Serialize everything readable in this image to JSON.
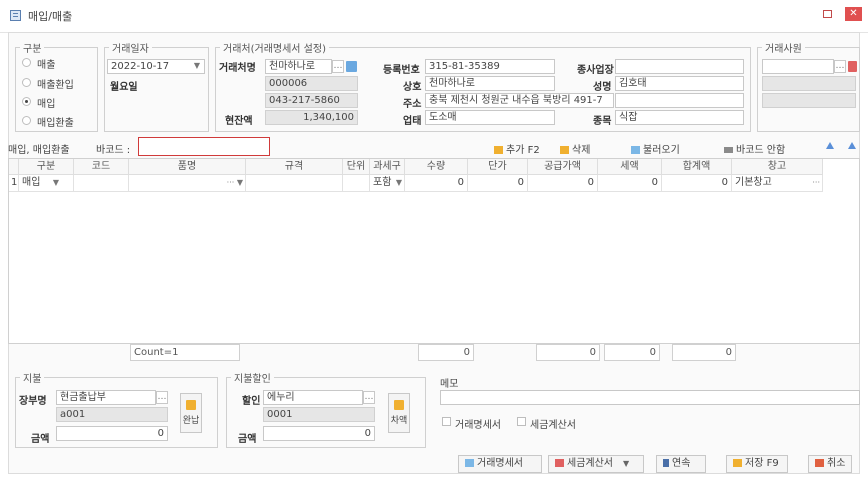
{
  "window": {
    "title": "매입/매출",
    "close_glyph": "✕"
  },
  "type_group": {
    "legend": "구분",
    "options": [
      {
        "label": "매출",
        "selected": false
      },
      {
        "label": "매출환입",
        "selected": false
      },
      {
        "label": "매입",
        "selected": true
      },
      {
        "label": "매입환출",
        "selected": false
      }
    ]
  },
  "date_group": {
    "legend": "거래일자",
    "date": "2022-10-17",
    "weekday": "월요일"
  },
  "partner_group": {
    "legend": "거래처(거래명세서 설정)",
    "name_label": "거래처명",
    "name_value": "천마하나로",
    "code": "000006",
    "phone": "043-217-5860",
    "balance_label": "현잔액",
    "balance": "1,340,100",
    "reg_no_label": "등록번호",
    "reg_no": "315-81-35389",
    "branch_label": "종사업장",
    "branch": "",
    "company_label": "상호",
    "company": "천마하나로",
    "ceo_label": "성명",
    "ceo": "김호태",
    "address_label": "주소",
    "address": "충북 제천시 청원군 내수읍 북방리 491-7",
    "business_label": "업태",
    "business": "도소매",
    "category_label": "종목",
    "category": "식잡"
  },
  "staff_group": {
    "legend": "거래사원"
  },
  "barcode_bar": {
    "mode_label": "매입, 매입환출",
    "barcode_label": "바코드 :",
    "barcode_value": "",
    "add_label": "추가 F2",
    "delete_label": "삭제",
    "load_label": "불러오기",
    "barcode_guide_label": "바코드 안함"
  },
  "grid": {
    "columns": [
      "구분",
      "코드",
      "품명",
      "규격",
      "단위",
      "과세구",
      "수량",
      "단가",
      "공급가액",
      "세액",
      "합계액",
      "창고"
    ],
    "rows": [
      {
        "no": "1",
        "type": "매입",
        "code": "",
        "name": "",
        "spec": "",
        "unit": "",
        "tax": "포함",
        "qty": "0",
        "price": "0",
        "supply": "0",
        "vat": "0",
        "total": "0",
        "warehouse": "기본창고"
      }
    ],
    "footer": {
      "count": "Count=1",
      "qty": "0",
      "supply": "0",
      "vat": "0",
      "total": "0"
    }
  },
  "payment_group": {
    "legend": "지불",
    "account_label": "장부명",
    "account_value": "현금출납부",
    "account_code": "a001",
    "amount_label": "금액",
    "amount": "0",
    "button_label": "완납"
  },
  "discount_group": {
    "legend": "지불할인",
    "discount_label": "할인",
    "discount_value": "에누리",
    "discount_code": "0001",
    "amount_label": "금액",
    "amount": "0",
    "button_label": "차액"
  },
  "memo": {
    "label": "메모",
    "value": "",
    "check_statement": "거래명세서",
    "check_invoice": "세금계산서"
  },
  "footer_buttons": {
    "statement": "거래명세서",
    "invoice": "세금계산서",
    "continuous": "연속",
    "save": "저장 F9",
    "cancel": "취소"
  },
  "colors": {
    "accent": "#5a8fd8",
    "close": "#e05050",
    "highlight_border": "#d03a3a",
    "icon_orange": "#f0b030"
  }
}
